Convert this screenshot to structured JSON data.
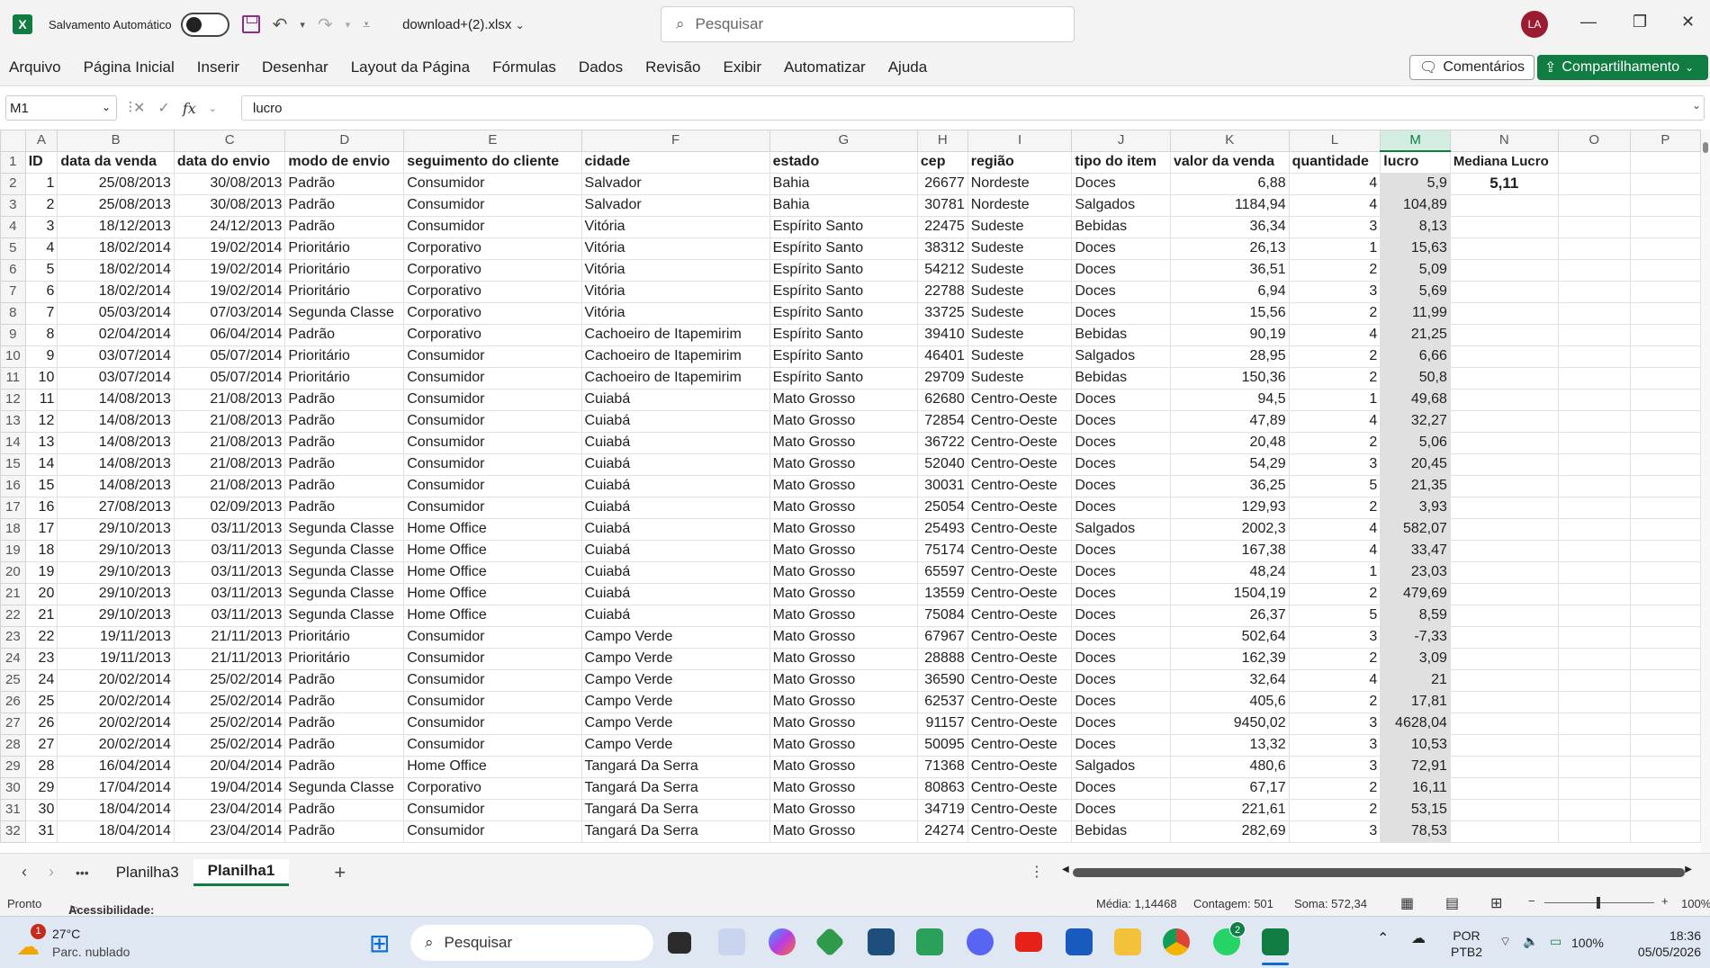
{
  "titlebar": {
    "app_logo": "X",
    "autosave_label": "Salvamento Automático",
    "filename": "download+(2).xlsx",
    "search_placeholder": "Pesquisar",
    "avatar_initials": "LA"
  },
  "menu": {
    "items": [
      "Arquivo",
      "Página Inicial",
      "Inserir",
      "Desenhar",
      "Layout da Página",
      "Fórmulas",
      "Dados",
      "Revisão",
      "Exibir",
      "Automatizar",
      "Ajuda"
    ],
    "comments_label": "Comentários",
    "share_label": "Compartilhamento"
  },
  "formula_bar": {
    "name_box": "M1",
    "formula": "lucro"
  },
  "grid": {
    "columns": [
      "A",
      "B",
      "C",
      "D",
      "E",
      "F",
      "G",
      "H",
      "I",
      "J",
      "K",
      "L",
      "M",
      "N",
      "O",
      "P"
    ],
    "selected_column": "M",
    "headers": [
      "ID",
      "data da venda",
      "data do envio",
      "modo de envio",
      "seguimento do cliente",
      "cidade",
      "estado",
      "cep",
      "região",
      "tipo do item",
      "valor da venda",
      "quantidade",
      "lucro"
    ],
    "median_label": "Mediana Lucro",
    "median_value": "5,11",
    "rows": [
      [
        "1",
        "25/08/2013",
        "30/08/2013",
        "Padrão",
        "Consumidor",
        "Salvador",
        "Bahia",
        "26677",
        "Nordeste",
        "Doces",
        "6,88",
        "4",
        "5,9"
      ],
      [
        "2",
        "25/08/2013",
        "30/08/2013",
        "Padrão",
        "Consumidor",
        "Salvador",
        "Bahia",
        "30781",
        "Nordeste",
        "Salgados",
        "1184,94",
        "4",
        "104,89"
      ],
      [
        "3",
        "18/12/2013",
        "24/12/2013",
        "Padrão",
        "Consumidor",
        "Vitória",
        "Espírito Santo",
        "22475",
        "Sudeste",
        "Bebidas",
        "36,34",
        "3",
        "8,13"
      ],
      [
        "4",
        "18/02/2014",
        "19/02/2014",
        "Prioritário",
        "Corporativo",
        "Vitória",
        "Espírito Santo",
        "38312",
        "Sudeste",
        "Doces",
        "26,13",
        "1",
        "15,63"
      ],
      [
        "5",
        "18/02/2014",
        "19/02/2014",
        "Prioritário",
        "Corporativo",
        "Vitória",
        "Espírito Santo",
        "54212",
        "Sudeste",
        "Doces",
        "36,51",
        "2",
        "5,09"
      ],
      [
        "6",
        "18/02/2014",
        "19/02/2014",
        "Prioritário",
        "Corporativo",
        "Vitória",
        "Espírito Santo",
        "22788",
        "Sudeste",
        "Doces",
        "6,94",
        "3",
        "5,69"
      ],
      [
        "7",
        "05/03/2014",
        "07/03/2014",
        "Segunda Classe",
        "Corporativo",
        "Vitória",
        "Espírito Santo",
        "33725",
        "Sudeste",
        "Doces",
        "15,56",
        "2",
        "11,99"
      ],
      [
        "8",
        "02/04/2014",
        "06/04/2014",
        "Padrão",
        "Corporativo",
        "Cachoeiro de Itapemirim",
        "Espírito Santo",
        "39410",
        "Sudeste",
        "Bebidas",
        "90,19",
        "4",
        "21,25"
      ],
      [
        "9",
        "03/07/2014",
        "05/07/2014",
        "Prioritário",
        "Consumidor",
        "Cachoeiro de Itapemirim",
        "Espírito Santo",
        "46401",
        "Sudeste",
        "Salgados",
        "28,95",
        "2",
        "6,66"
      ],
      [
        "10",
        "03/07/2014",
        "05/07/2014",
        "Prioritário",
        "Consumidor",
        "Cachoeiro de Itapemirim",
        "Espírito Santo",
        "29709",
        "Sudeste",
        "Bebidas",
        "150,36",
        "2",
        "50,8"
      ],
      [
        "11",
        "14/08/2013",
        "21/08/2013",
        "Padrão",
        "Consumidor",
        "Cuiabá",
        "Mato Grosso",
        "62680",
        "Centro-Oeste",
        "Doces",
        "94,5",
        "1",
        "49,68"
      ],
      [
        "12",
        "14/08/2013",
        "21/08/2013",
        "Padrão",
        "Consumidor",
        "Cuiabá",
        "Mato Grosso",
        "72854",
        "Centro-Oeste",
        "Doces",
        "47,89",
        "4",
        "32,27"
      ],
      [
        "13",
        "14/08/2013",
        "21/08/2013",
        "Padrão",
        "Consumidor",
        "Cuiabá",
        "Mato Grosso",
        "36722",
        "Centro-Oeste",
        "Doces",
        "20,48",
        "2",
        "5,06"
      ],
      [
        "14",
        "14/08/2013",
        "21/08/2013",
        "Padrão",
        "Consumidor",
        "Cuiabá",
        "Mato Grosso",
        "52040",
        "Centro-Oeste",
        "Doces",
        "54,29",
        "3",
        "20,45"
      ],
      [
        "15",
        "14/08/2013",
        "21/08/2013",
        "Padrão",
        "Consumidor",
        "Cuiabá",
        "Mato Grosso",
        "30031",
        "Centro-Oeste",
        "Doces",
        "36,25",
        "5",
        "21,35"
      ],
      [
        "16",
        "27/08/2013",
        "02/09/2013",
        "Padrão",
        "Consumidor",
        "Cuiabá",
        "Mato Grosso",
        "25054",
        "Centro-Oeste",
        "Doces",
        "129,93",
        "2",
        "3,93"
      ],
      [
        "17",
        "29/10/2013",
        "03/11/2013",
        "Segunda Classe",
        "Home Office",
        "Cuiabá",
        "Mato Grosso",
        "25493",
        "Centro-Oeste",
        "Salgados",
        "2002,3",
        "4",
        "582,07"
      ],
      [
        "18",
        "29/10/2013",
        "03/11/2013",
        "Segunda Classe",
        "Home Office",
        "Cuiabá",
        "Mato Grosso",
        "75174",
        "Centro-Oeste",
        "Doces",
        "167,38",
        "4",
        "33,47"
      ],
      [
        "19",
        "29/10/2013",
        "03/11/2013",
        "Segunda Classe",
        "Home Office",
        "Cuiabá",
        "Mato Grosso",
        "65597",
        "Centro-Oeste",
        "Doces",
        "48,24",
        "1",
        "23,03"
      ],
      [
        "20",
        "29/10/2013",
        "03/11/2013",
        "Segunda Classe",
        "Home Office",
        "Cuiabá",
        "Mato Grosso",
        "13559",
        "Centro-Oeste",
        "Doces",
        "1504,19",
        "2",
        "479,69"
      ],
      [
        "21",
        "29/10/2013",
        "03/11/2013",
        "Segunda Classe",
        "Home Office",
        "Cuiabá",
        "Mato Grosso",
        "75084",
        "Centro-Oeste",
        "Doces",
        "26,37",
        "5",
        "8,59"
      ],
      [
        "22",
        "19/11/2013",
        "21/11/2013",
        "Prioritário",
        "Consumidor",
        "Campo Verde",
        "Mato Grosso",
        "67967",
        "Centro-Oeste",
        "Doces",
        "502,64",
        "3",
        "-7,33"
      ],
      [
        "23",
        "19/11/2013",
        "21/11/2013",
        "Prioritário",
        "Consumidor",
        "Campo Verde",
        "Mato Grosso",
        "28888",
        "Centro-Oeste",
        "Doces",
        "162,39",
        "2",
        "3,09"
      ],
      [
        "24",
        "20/02/2014",
        "25/02/2014",
        "Padrão",
        "Consumidor",
        "Campo Verde",
        "Mato Grosso",
        "36590",
        "Centro-Oeste",
        "Doces",
        "32,64",
        "4",
        "21"
      ],
      [
        "25",
        "20/02/2014",
        "25/02/2014",
        "Padrão",
        "Consumidor",
        "Campo Verde",
        "Mato Grosso",
        "62537",
        "Centro-Oeste",
        "Doces",
        "405,6",
        "2",
        "17,81"
      ],
      [
        "26",
        "20/02/2014",
        "25/02/2014",
        "Padrão",
        "Consumidor",
        "Campo Verde",
        "Mato Grosso",
        "91157",
        "Centro-Oeste",
        "Doces",
        "9450,02",
        "3",
        "4628,04"
      ],
      [
        "27",
        "20/02/2014",
        "25/02/2014",
        "Padrão",
        "Consumidor",
        "Campo Verde",
        "Mato Grosso",
        "50095",
        "Centro-Oeste",
        "Doces",
        "13,32",
        "3",
        "10,53"
      ],
      [
        "28",
        "16/04/2014",
        "20/04/2014",
        "Padrão",
        "Home Office",
        "Tangará Da Serra",
        "Mato Grosso",
        "71368",
        "Centro-Oeste",
        "Salgados",
        "480,6",
        "3",
        "72,91"
      ],
      [
        "29",
        "17/04/2014",
        "19/04/2014",
        "Segunda Classe",
        "Corporativo",
        "Tangará Da Serra",
        "Mato Grosso",
        "80863",
        "Centro-Oeste",
        "Doces",
        "67,17",
        "2",
        "16,11"
      ],
      [
        "30",
        "18/04/2014",
        "23/04/2014",
        "Padrão",
        "Consumidor",
        "Tangará Da Serra",
        "Mato Grosso",
        "34719",
        "Centro-Oeste",
        "Doces",
        "221,61",
        "2",
        "53,15"
      ],
      [
        "31",
        "18/04/2014",
        "23/04/2014",
        "Padrão",
        "Consumidor",
        "Tangará Da Serra",
        "Mato Grosso",
        "24274",
        "Centro-Oeste",
        "Bebidas",
        "282,69",
        "3",
        "78,53"
      ]
    ]
  },
  "tabs": {
    "more": "•••",
    "items": [
      "Planilha3",
      "Planilha1"
    ],
    "active": "Planilha1",
    "add": "+"
  },
  "status": {
    "ready": "Pronto",
    "accessibility": "Acessibilidade: investigar",
    "average": "Média: 1,14468",
    "count": "Contagem: 501",
    "sum": "Soma: 572,34",
    "zoom": "100%"
  },
  "taskbar": {
    "weather_temp": "27°C",
    "weather_desc": "Parc. nublado",
    "weather_badge": "1",
    "search_placeholder": "Pesquisar",
    "whatsapp_badge": "2",
    "lang_top": "POR",
    "lang_bottom": "PTB2",
    "battery": "100%",
    "time": "18:36",
    "date": "05/05/2026"
  },
  "colors": {
    "excel_green": "#107c41",
    "selected_col_header": "#d3ede0",
    "lucro_fill": "#e0e0e0",
    "avatar": "#9b1b30"
  }
}
